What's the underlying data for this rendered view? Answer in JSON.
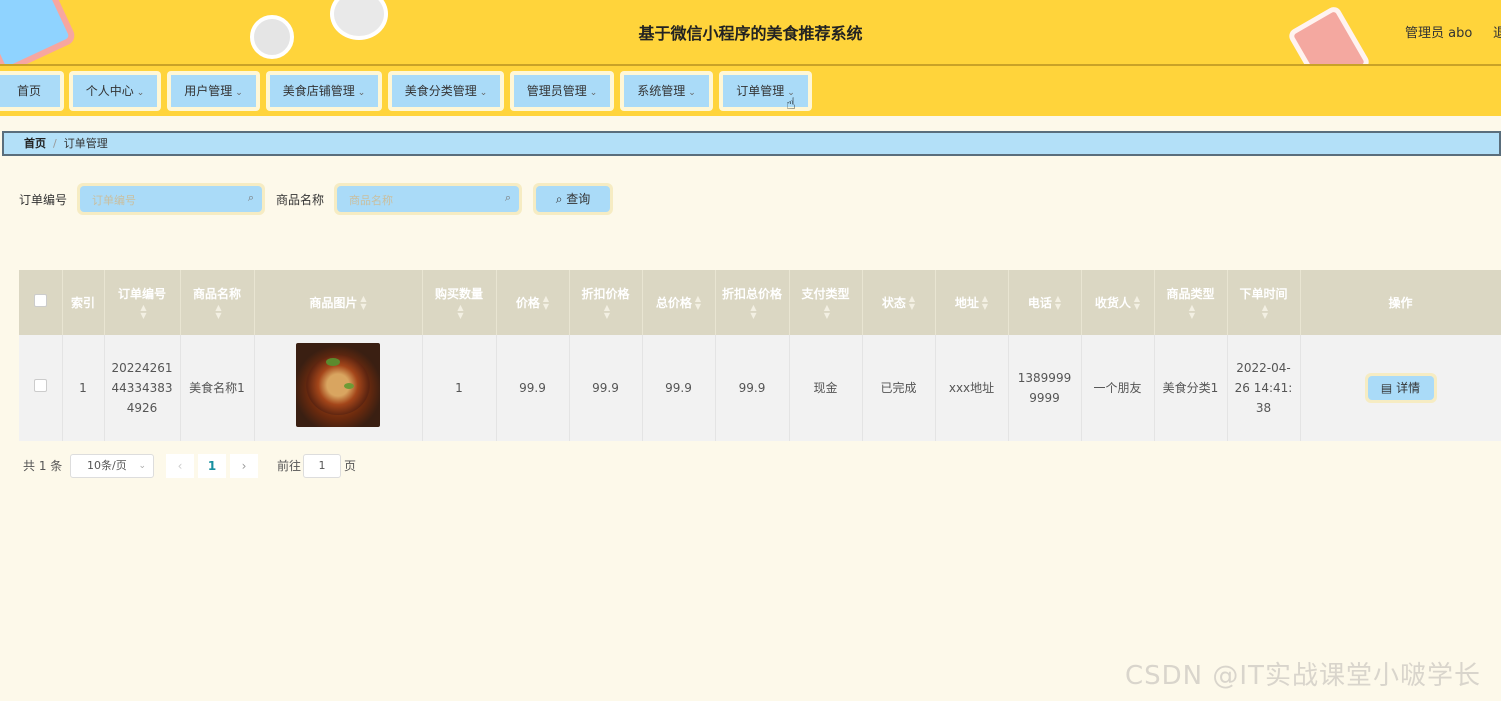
{
  "header": {
    "title": "基于微信小程序的美食推荐系统",
    "user_label": "管理员 abo",
    "logout_label": "退"
  },
  "nav": {
    "items": [
      {
        "label": "首页",
        "dropdown": false
      },
      {
        "label": "个人中心",
        "dropdown": true
      },
      {
        "label": "用户管理",
        "dropdown": true
      },
      {
        "label": "美食店铺管理",
        "dropdown": true
      },
      {
        "label": "美食分类管理",
        "dropdown": true
      },
      {
        "label": "管理员管理",
        "dropdown": true
      },
      {
        "label": "系统管理",
        "dropdown": true
      },
      {
        "label": "订单管理",
        "dropdown": true
      }
    ]
  },
  "breadcrumb": {
    "home": "首页",
    "current": "订单管理"
  },
  "search": {
    "order_no_label": "订单编号",
    "order_no_placeholder": "订单编号",
    "order_no_value": "",
    "product_name_label": "商品名称",
    "product_name_placeholder": "商品名称",
    "product_name_value": "",
    "query_label": "查询"
  },
  "table": {
    "columns": [
      "索引",
      "订单编号",
      "商品名称",
      "商品图片",
      "购买数量",
      "价格",
      "折扣价格",
      "总价格",
      "折扣总价格",
      "支付类型",
      "状态",
      "地址",
      "电话",
      "收货人",
      "商品类型",
      "下单时间",
      "操作"
    ],
    "rows": [
      {
        "index": "1",
        "order_no": "202242614433438349 26",
        "order_no_display": "20224261443343834926",
        "product_name": "美食名称1",
        "quantity": "1",
        "price": "99.9",
        "discount_price": "99.9",
        "total_price": "99.9",
        "discount_total": "99.9",
        "pay_type": "现金",
        "status": "已完成",
        "address": "xxx地址",
        "phone": "13899999999",
        "receiver": "一个朋友",
        "category": "美食分类1",
        "order_time": "2022-04-26 14:41:38",
        "action_label": "详情"
      }
    ]
  },
  "pagination": {
    "total_label": "共 1 条",
    "page_size_label": "10条/页",
    "current_page": "1",
    "goto_prefix": "前往",
    "goto_value": "1",
    "goto_suffix": "页"
  },
  "watermark": "CSDN @IT实战课堂小啵学长",
  "colors": {
    "header_bg": "#ffd43b",
    "nav_item_bg": "#aadbf8",
    "page_bg": "#fdf9ea",
    "table_header_bg": "#dbd7c3"
  }
}
